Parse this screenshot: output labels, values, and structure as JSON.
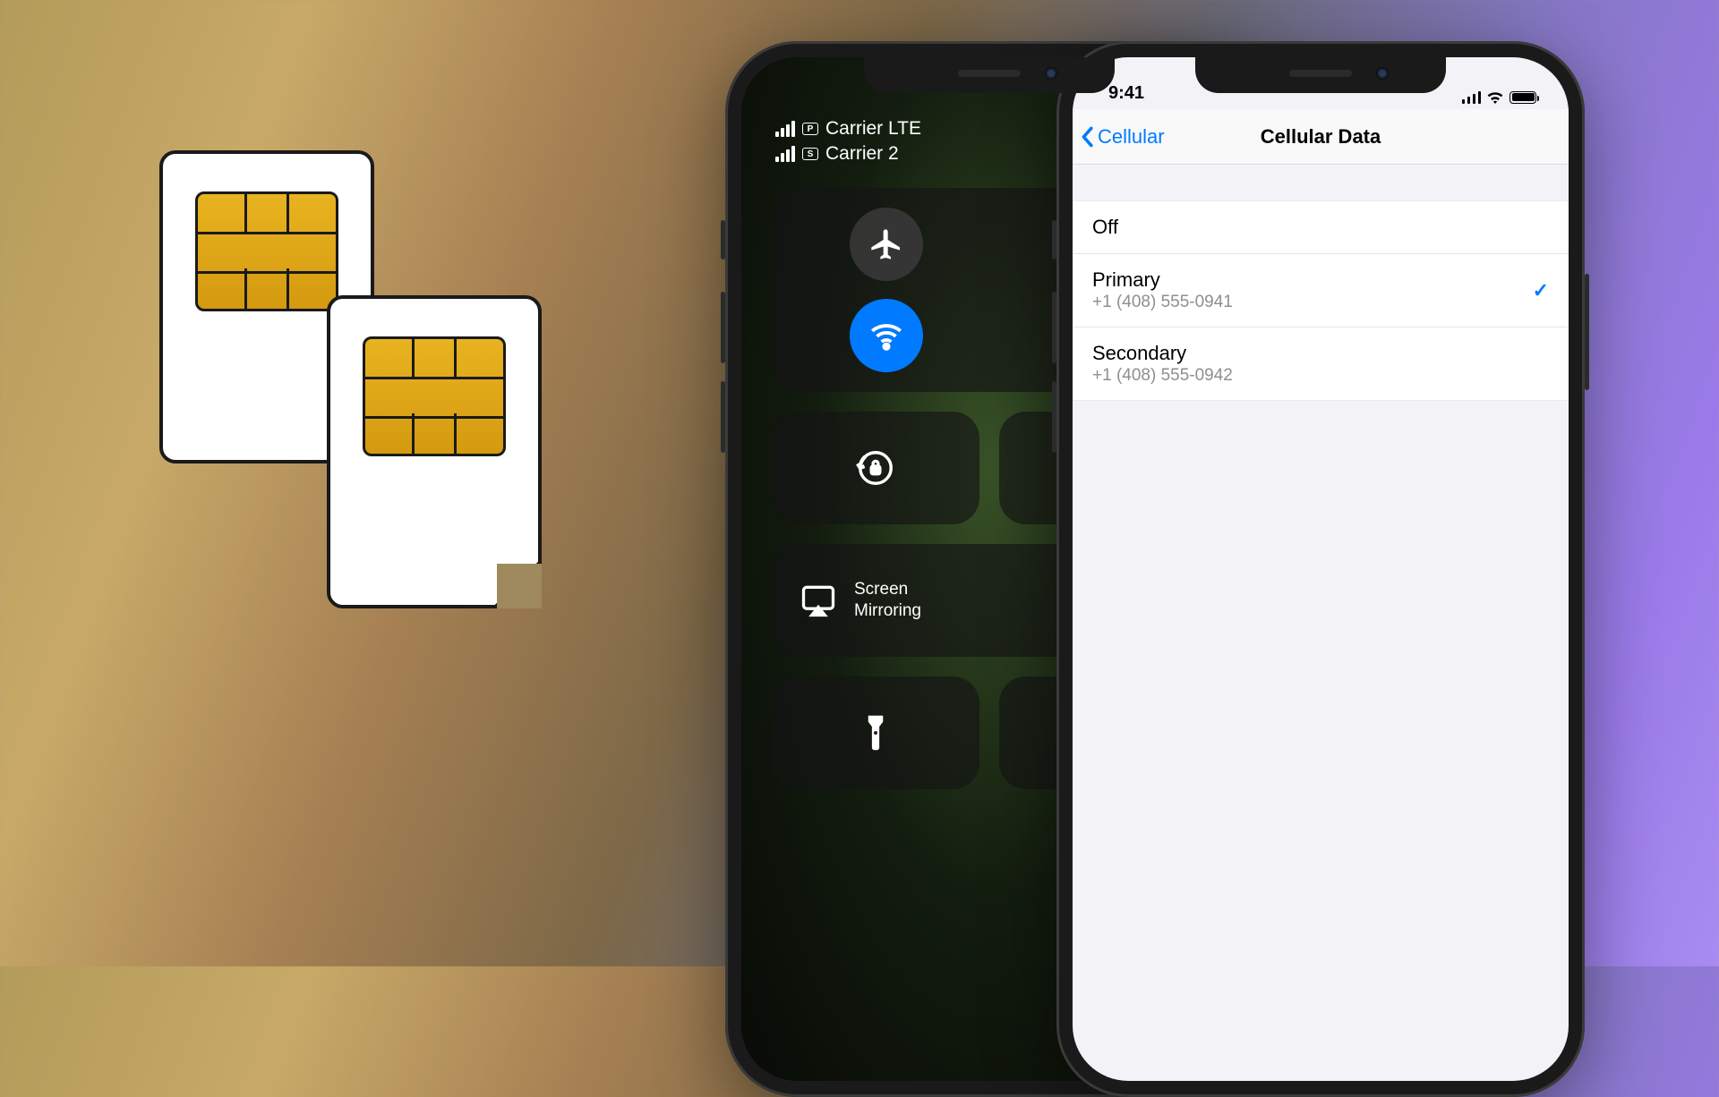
{
  "control_center": {
    "carriers": [
      {
        "badge": "P",
        "label": "Carrier LTE"
      },
      {
        "badge": "S",
        "label": "Carrier 2"
      }
    ],
    "screen_mirroring": "Screen\nMirroring"
  },
  "settings": {
    "status_time": "9:41",
    "back_label": "Cellular",
    "title": "Cellular Data",
    "rows": [
      {
        "title": "Off",
        "sub": "",
        "checked": false
      },
      {
        "title": "Primary",
        "sub": "+1 (408) 555-0941",
        "checked": true
      },
      {
        "title": "Secondary",
        "sub": "+1 (408) 555-0942",
        "checked": false
      }
    ]
  }
}
